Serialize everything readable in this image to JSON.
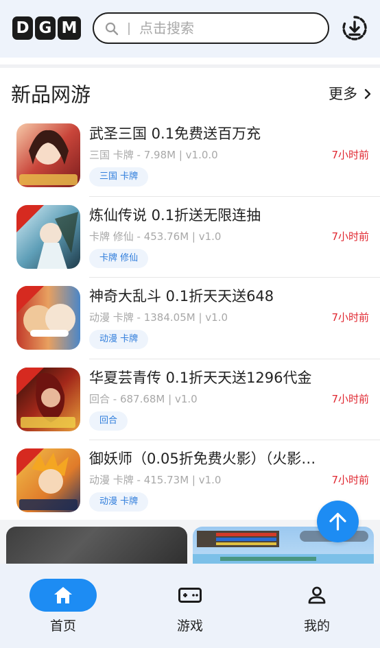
{
  "header": {
    "logo_text": "DGM",
    "logo_letters": [
      "D",
      "G",
      "M"
    ],
    "search_placeholder": "点击搜索"
  },
  "section": {
    "title": "新品网游",
    "more_label": "更多"
  },
  "games": [
    {
      "name": "武圣三国 0.1免费送百万充",
      "meta": "三国 卡牌 - 7.98M | v1.0.0",
      "time": "7小时前",
      "tag": "三国 卡牌",
      "icon": "game-icon-wusheng"
    },
    {
      "name": "炼仙传说 0.1折送无限连抽",
      "meta": "卡牌 修仙 - 453.76M | v1.0",
      "time": "7小时前",
      "tag": "卡牌 修仙",
      "icon": "game-icon-lianxian"
    },
    {
      "name": "神奇大乱斗 0.1折天天送648",
      "meta": "动漫 卡牌 - 1384.05M | v1.0",
      "time": "7小时前",
      "tag": "动漫 卡牌",
      "icon": "game-icon-shenqi"
    },
    {
      "name": "华夏芸青传 0.1折天天送1296代金",
      "meta": "回合 - 687.68M | v1.0",
      "time": "7小时前",
      "tag": "回合",
      "icon": "game-icon-huaxia"
    },
    {
      "name": "御妖师（0.05折免费火影）（火影…",
      "meta": "动漫 卡牌 - 415.73M | v1.0",
      "time": "7小时前",
      "tag": "动漫 卡牌",
      "icon": "game-icon-yuyaoshi"
    }
  ],
  "tabs": [
    {
      "label": "首页",
      "icon": "home-icon",
      "active": true
    },
    {
      "label": "游戏",
      "icon": "gamepad-icon",
      "active": false
    },
    {
      "label": "我的",
      "icon": "user-icon",
      "active": false
    }
  ],
  "colors": {
    "accent": "#1d8cf3",
    "time_red": "#e0262f",
    "tag_text": "#2f7ddb",
    "tag_bg": "#eef4fc",
    "header_bg": "#eef3fb"
  }
}
